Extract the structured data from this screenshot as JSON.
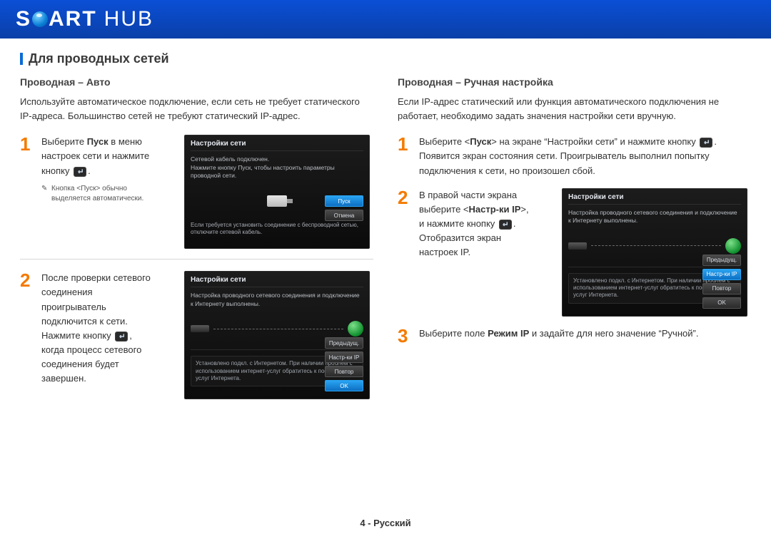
{
  "header": {
    "brand_1": "S",
    "brand_2": "ART",
    "brand_3": "HUB"
  },
  "section_title": "Для проводных сетей",
  "footer": "4 - Русский",
  "left": {
    "subtitle": "Проводная – Авто",
    "intro": "Используйте автоматическое подключение, если сеть не требует статического IP-адреса. Большинство сетей не требуют статический IP-адрес.",
    "s1": {
      "n": "1",
      "t1": "Выберите ",
      "bold": "Пуск",
      "t2": " в меню настроек сети и нажмите кнопку ",
      "t3": ".",
      "note": "Кнопка <Пуск> обычно выделяется автоматически."
    },
    "s1_tv": {
      "title": "Настройки сети",
      "msg": "Сетевой кабель подключен.\nНажмите кнопку Пуск, чтобы настроить параметры проводной сети.",
      "hint": "Если требуется установить соединение с беспроводной сетью, отключите сетевой кабель.",
      "b1": "Пуск",
      "b2": "Отмена"
    },
    "s2": {
      "n": "2",
      "t1": "После проверки сетевого соединения проигрыватель подключится к сети. Нажмите кнопку ",
      "t2": ", когда процесс сетевого соединения будет завершен."
    },
    "s2_tv": {
      "title": "Настройки сети",
      "msg": "Настройка проводного сетевого соединения и подключение к Интернету выполнены.",
      "status": "Установлено подкл. с Интернетом. При наличии проблем с использованием интернет-услуг обратитесь к поставщику услуг Интернета.",
      "b1": "Предыдущ.",
      "b2": "Настр-ки IP",
      "b3": "Повтор",
      "b4": "OK"
    }
  },
  "right": {
    "subtitle": "Проводная – Ручная настройка",
    "intro": "Если IP-адрес статический или функция автоматического подключения не работает, необходимо задать значения настройки сети вручную.",
    "s1": {
      "n": "1",
      "t1": "Выберите <",
      "bold": "Пуск",
      "t2": "> на экране “Настройки сети” и нажмите кнопку ",
      "t3": ". Появится экран состояния сети. Проигрыватель выполнил попытку подключения к сети, но произошел сбой."
    },
    "s2": {
      "n": "2",
      "t1": "В правой части экрана выберите <",
      "bold": "Настр-ки IP",
      "t2": ">, и нажмите кнопку ",
      "t3": ". Отобразится экран настроек IP."
    },
    "s2_tv": {
      "title": "Настройки сети",
      "msg": "Настройка проводного сетевого соединения и подключение к Интернету выполнены.",
      "status": "Установлено подкл. с Интернетом. При наличии проблем с использованием интернет-услуг обратитесь к поставщику услуг Интернета.",
      "b1": "Предыдущ.",
      "b2": "Настр-ки IP",
      "b3": "Повтор",
      "b4": "OK"
    },
    "s3": {
      "n": "3",
      "t1": "Выберите поле ",
      "bold": "Режим IP",
      "t2": " и задайте для него значение “Ручной”."
    }
  }
}
